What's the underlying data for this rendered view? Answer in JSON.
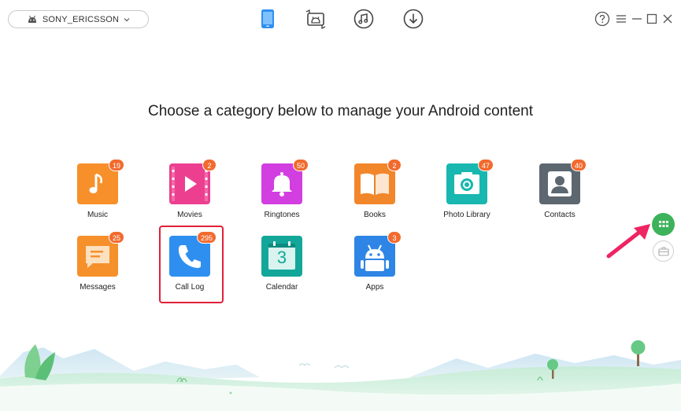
{
  "header": {
    "device_name": "SONY_ERICSSON",
    "device_icon": "android-icon",
    "dropdown_icon": "chevron-down-icon",
    "nav_tabs": [
      {
        "name": "device-manager",
        "icon": "phone-icon",
        "active": true
      },
      {
        "name": "android-mover",
        "icon": "device-transfer-icon",
        "active": false
      },
      {
        "name": "media-library",
        "icon": "music-icon",
        "active": false
      },
      {
        "name": "downloader",
        "icon": "download-icon",
        "active": false
      }
    ],
    "window_controls": [
      "help-icon",
      "menu-icon",
      "minimize-icon",
      "maximize-icon",
      "close-icon"
    ]
  },
  "main": {
    "title": "Choose a category below to manage your Android content",
    "categories": [
      {
        "label": "Music",
        "count": "19",
        "icon": "music-note-icon",
        "color": "#f7902a"
      },
      {
        "label": "Movies",
        "count": "2",
        "icon": "film-icon",
        "color": "#ec3f8f"
      },
      {
        "label": "Ringtones",
        "count": "50",
        "icon": "bell-icon",
        "color": "#d23ee0"
      },
      {
        "label": "Books",
        "count": "2",
        "icon": "book-icon",
        "color": "#f2862b"
      },
      {
        "label": "Photo Library",
        "count": "47",
        "icon": "camera-icon",
        "color": "#18b7b0"
      },
      {
        "label": "Contacts",
        "count": "40",
        "icon": "person-icon",
        "color": "#5d6770"
      },
      {
        "label": "Messages",
        "count": "25",
        "icon": "message-icon",
        "color": "#f6902b"
      },
      {
        "label": "Call Log",
        "count": "295",
        "icon": "phone-handset-icon",
        "color": "#2e8ff0",
        "selected": true
      },
      {
        "label": "Calendar",
        "count": "",
        "icon": "calendar-icon",
        "color": "#13a79a",
        "day": "3"
      },
      {
        "label": "Apps",
        "count": "3",
        "icon": "android-app-icon",
        "color": "#2e85e6"
      }
    ]
  },
  "side_panel": {
    "buttons": [
      {
        "name": "category-view",
        "icon": "grid-icon",
        "active": true,
        "color": "#3cb25b"
      },
      {
        "name": "toolbox-view",
        "icon": "briefcase-icon",
        "active": false
      }
    ],
    "annotation_color": "#ee2463"
  },
  "colors": {
    "badge": "#f26a2e",
    "selection": "#e0203a",
    "accent_blue": "#2e8ff0"
  }
}
